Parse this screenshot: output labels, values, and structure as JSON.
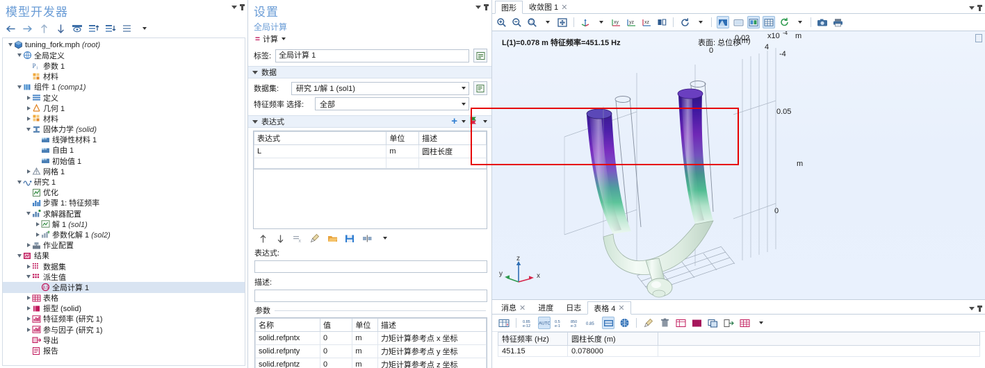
{
  "model_builder": {
    "title": "模型开发器",
    "toolbar": [
      {
        "name": "back-icon",
        "glyph": "←"
      },
      {
        "name": "forward-icon",
        "glyph": "→"
      },
      {
        "name": "up-icon",
        "glyph": "↑"
      },
      {
        "name": "down-icon",
        "glyph": "↓"
      },
      {
        "name": "show-icon",
        "glyph": "show"
      },
      {
        "name": "collapse-all-icon",
        "glyph": "list-up"
      },
      {
        "name": "expand-all-icon",
        "glyph": "list-down"
      },
      {
        "name": "list-icon",
        "glyph": "list"
      },
      {
        "name": "toolbar-dropdown-icon",
        "glyph": "caret"
      }
    ],
    "tree": [
      {
        "depth": 0,
        "expander": "open",
        "icon": "root-icon",
        "label": "tuning_fork.mph",
        "italic": "(root)",
        "selected": false
      },
      {
        "depth": 1,
        "expander": "open",
        "icon": "globe-icon",
        "label": "全局定义",
        "italic": "",
        "selected": false
      },
      {
        "depth": 2,
        "expander": "none",
        "icon": "parameters-icon",
        "label": "参数 1",
        "italic": "",
        "selected": false
      },
      {
        "depth": 2,
        "expander": "none",
        "icon": "materials-icon",
        "label": "材料",
        "italic": "",
        "selected": false
      },
      {
        "depth": 1,
        "expander": "open",
        "icon": "component-icon",
        "label": "组件 1",
        "italic": "(comp1)",
        "selected": false
      },
      {
        "depth": 2,
        "expander": "closed",
        "icon": "definitions-icon",
        "label": "定义",
        "italic": "",
        "selected": false
      },
      {
        "depth": 2,
        "expander": "closed",
        "icon": "geometry-icon",
        "label": "几何 1",
        "italic": "",
        "selected": false
      },
      {
        "depth": 2,
        "expander": "closed",
        "icon": "materials-icon",
        "label": "材料",
        "italic": "",
        "selected": false
      },
      {
        "depth": 2,
        "expander": "open",
        "icon": "physics-icon",
        "label": "固体力学",
        "italic": "(solid)",
        "selected": false
      },
      {
        "depth": 3,
        "expander": "none",
        "icon": "node-icon",
        "label": "线弹性材料 1",
        "italic": "",
        "selected": false
      },
      {
        "depth": 3,
        "expander": "none",
        "icon": "node-icon",
        "label": "自由 1",
        "italic": "",
        "selected": false
      },
      {
        "depth": 3,
        "expander": "none",
        "icon": "node-icon",
        "label": "初始值 1",
        "italic": "",
        "selected": false
      },
      {
        "depth": 2,
        "expander": "closed",
        "icon": "mesh-icon",
        "label": "网格 1",
        "italic": "",
        "selected": false
      },
      {
        "depth": 1,
        "expander": "open",
        "icon": "study-icon",
        "label": "研究 1",
        "italic": "",
        "selected": false
      },
      {
        "depth": 2,
        "expander": "none",
        "icon": "optimization-icon",
        "label": "优化",
        "italic": "",
        "selected": false
      },
      {
        "depth": 2,
        "expander": "none",
        "icon": "eigenfreq-step-icon",
        "label": "步骤 1: 特征频率",
        "italic": "",
        "selected": false
      },
      {
        "depth": 2,
        "expander": "open",
        "icon": "solver-config-icon",
        "label": "求解器配置",
        "italic": "",
        "selected": false
      },
      {
        "depth": 3,
        "expander": "closed",
        "icon": "solution-icon",
        "label": "解 1",
        "italic": "(sol1)",
        "selected": false
      },
      {
        "depth": 3,
        "expander": "closed",
        "icon": "param-solution-icon",
        "label": "参数化解 1",
        "italic": "(sol2)",
        "selected": false
      },
      {
        "depth": 2,
        "expander": "closed",
        "icon": "job-config-icon",
        "label": "作业配置",
        "italic": "",
        "selected": false
      },
      {
        "depth": 1,
        "expander": "open",
        "icon": "results-icon",
        "label": "结果",
        "italic": "",
        "selected": false
      },
      {
        "depth": 2,
        "expander": "closed",
        "icon": "datasets-icon",
        "label": "数据集",
        "italic": "",
        "selected": false
      },
      {
        "depth": 2,
        "expander": "open",
        "icon": "derived-values-icon",
        "label": "派生值",
        "italic": "",
        "selected": false
      },
      {
        "depth": 3,
        "expander": "none",
        "icon": "global-evaluation-icon",
        "label": "全局计算 1",
        "italic": "",
        "selected": true
      },
      {
        "depth": 2,
        "expander": "closed",
        "icon": "tables-icon",
        "label": "表格",
        "italic": "",
        "selected": false
      },
      {
        "depth": 2,
        "expander": "closed",
        "icon": "modeshape-icon",
        "label": "振型 (solid)",
        "italic": "",
        "selected": false
      },
      {
        "depth": 2,
        "expander": "closed",
        "icon": "plot-group-icon",
        "label": "特征频率 (研究 1)",
        "italic": "",
        "selected": false
      },
      {
        "depth": 2,
        "expander": "closed",
        "icon": "plot-group-icon",
        "label": "参与因子 (研究 1)",
        "italic": "",
        "selected": false
      },
      {
        "depth": 2,
        "expander": "none",
        "icon": "export-icon",
        "label": "导出",
        "italic": "",
        "selected": false
      },
      {
        "depth": 2,
        "expander": "none",
        "icon": "report-icon",
        "label": "报告",
        "italic": "",
        "selected": false
      }
    ]
  },
  "settings": {
    "title": "设置",
    "node_type": "全局计算",
    "action_label": "计算",
    "label_caption": "标签:",
    "label_value": "全局计算 1",
    "data_section": {
      "header": "数据",
      "dataset_caption": "数据集:",
      "dataset_value": "研究 1/解 1 (sol1)",
      "eigenfreq_caption": "特征频率 选择:",
      "eigenfreq_value": "全部"
    },
    "expressions_section": {
      "header": "表达式",
      "add_icon": "plus-icon",
      "replace_icon": "replace-expression-icon",
      "columns": [
        "表达式",
        "单位",
        "描述"
      ],
      "rows": [
        {
          "expression": "L",
          "unit": "m",
          "description": "圆柱长度"
        },
        {
          "expression": "",
          "unit": "",
          "description": ""
        }
      ]
    },
    "expr_toolbar": [
      {
        "name": "move-up-icon",
        "glyph": "↑"
      },
      {
        "name": "move-down-icon",
        "glyph": "↓"
      },
      {
        "name": "delete-row-icon",
        "glyph": "del"
      },
      {
        "name": "clear-table-icon",
        "glyph": "broom"
      },
      {
        "name": "load-from-file-icon",
        "glyph": "folder"
      },
      {
        "name": "save-to-file-icon",
        "glyph": "save"
      },
      {
        "name": "column-settings-icon",
        "glyph": "cols"
      },
      {
        "name": "expr-toolbar-dropdown-icon",
        "glyph": "caret"
      }
    ],
    "expression_caption": "表达式:",
    "expression_value": "",
    "description_caption": "描述:",
    "description_value": "",
    "parameters_section": {
      "header": "参数",
      "columns": [
        "名称",
        "值",
        "单位",
        "描述"
      ],
      "rows": [
        {
          "name": "solid.refpntx",
          "value": "0",
          "unit": "m",
          "description": "力矩计算参考点 x 坐标"
        },
        {
          "name": "solid.refpnty",
          "value": "0",
          "unit": "m",
          "description": "力矩计算参考点 y 坐标"
        },
        {
          "name": "solid.refpntz",
          "value": "0",
          "unit": "m",
          "description": "力矩计算参考点 z 坐标"
        }
      ]
    }
  },
  "graphics": {
    "tabs": [
      {
        "label": "图形",
        "closable": false,
        "active": true
      },
      {
        "label": "收敛图 1",
        "closable": true,
        "active": false
      }
    ],
    "toolbar": [
      {
        "name": "zoom-in-icon"
      },
      {
        "name": "zoom-out-icon"
      },
      {
        "name": "zoom-box-icon"
      },
      {
        "name": "zoom-dropdown-icon"
      },
      {
        "name": "zoom-extents-icon"
      },
      {
        "name": "separator"
      },
      {
        "name": "go-to-default-view-icon"
      },
      {
        "name": "view-dropdown-icon"
      },
      {
        "name": "xy-view-icon"
      },
      {
        "name": "yz-view-icon"
      },
      {
        "name": "zx-view-icon"
      },
      {
        "name": "flip-view-icon"
      },
      {
        "name": "separator"
      },
      {
        "name": "reset-rotation-icon"
      },
      {
        "name": "rotation-dropdown-icon"
      },
      {
        "name": "separator"
      },
      {
        "name": "transparency-icon"
      },
      {
        "name": "scene-light-icon"
      },
      {
        "name": "show-legends-icon"
      },
      {
        "name": "show-grid-icon"
      },
      {
        "name": "refresh-icon"
      },
      {
        "name": "refresh-dropdown-icon"
      },
      {
        "name": "separator"
      },
      {
        "name": "snapshot-icon"
      },
      {
        "name": "print-icon"
      }
    ],
    "plot_title": "L(1)=0.078 m 特征频率=451.15 Hz",
    "legend_title": "表面: 总位移",
    "color_scale_max": "0.02",
    "color_scale_min": "0",
    "color_unit": "(m)",
    "axis_exponent_label": "x10",
    "axis_exponent_power": "-4",
    "axis_unit_top": "m",
    "axis_tick_top": "4",
    "axis_unit_right": "m",
    "axis_tick_right_high": "0.05",
    "axis_tick_right_low": "0",
    "triad": {
      "x": "x",
      "y": "y",
      "z": "z"
    }
  },
  "bottom_panel": {
    "tabs": [
      {
        "label": "消息",
        "closable": true,
        "active": false
      },
      {
        "label": "进度",
        "closable": false,
        "active": false
      },
      {
        "label": "日志",
        "closable": false,
        "active": false
      },
      {
        "label": "表格 4",
        "closable": true,
        "active": true
      }
    ],
    "toolbar": [
      {
        "name": "table-format-icon"
      },
      {
        "name": "number-format-icon"
      },
      {
        "name": "auto-format-icon"
      },
      {
        "name": "decimal-format-icon"
      },
      {
        "name": "scientific-format-icon"
      },
      {
        "name": "precision-format-icon"
      },
      {
        "name": "full-precision-icon"
      },
      {
        "name": "table-graph-icon"
      },
      {
        "name": "separator"
      },
      {
        "name": "clear-table-icon"
      },
      {
        "name": "delete-table-icon"
      },
      {
        "name": "export-table-icon"
      },
      {
        "name": "table-color-icon"
      },
      {
        "name": "copy-table-icon"
      },
      {
        "name": "export-to-file-icon"
      },
      {
        "name": "add-table-icon"
      },
      {
        "name": "table-dropdown-icon"
      }
    ],
    "table": {
      "columns": [
        "特征频率 (Hz)",
        "圆柱长度 (m)"
      ],
      "rows": [
        [
          "451.15",
          "0.078000"
        ]
      ]
    }
  },
  "colors": {
    "accent": "#6a9cd6",
    "section_bg": "#eaf1fa",
    "selection": "#d9e4f2",
    "highlight_box": "#e60000",
    "graphics_bg": "#eef4fd"
  }
}
